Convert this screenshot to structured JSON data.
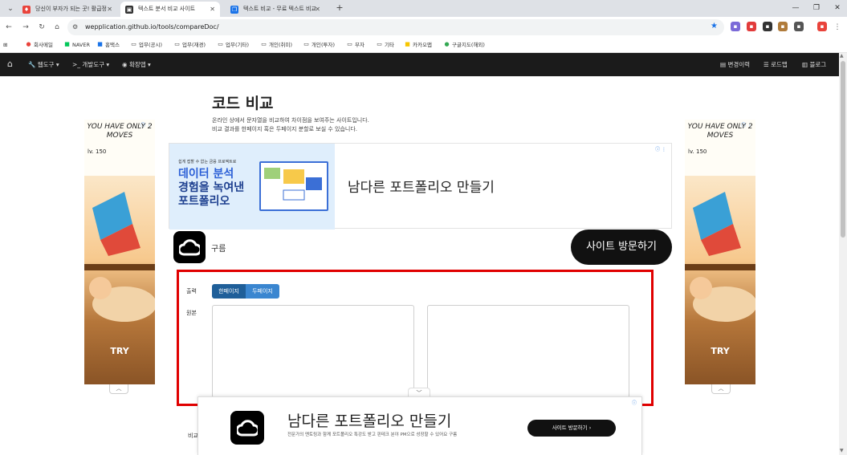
{
  "browser": {
    "tabs": [
      {
        "title": "당신이 부자가 되는 곳! 활급정",
        "active": false,
        "favicon_color": "#e9433b"
      },
      {
        "title": "텍스트 분서 비교 사이트",
        "active": true,
        "favicon_color": "#333333"
      },
      {
        "title": "텍스트 비교 - 무료 텍스트 비교",
        "active": false,
        "favicon_color": "#1a73e8"
      }
    ],
    "url": "wepplication.github.io/tools/compareDoc/",
    "bookmarks": [
      "회사메일",
      "NAVER",
      "홈택스",
      "업무(공시)",
      "업무(재경)",
      "업무(기타)",
      "개인(취미)",
      "개인(투자)",
      "부자",
      "기타",
      "카카오맵",
      "구글지도(해외)"
    ]
  },
  "navbar": {
    "left": [
      "웹도구 ▾",
      "개발도구 ▾",
      "확장앱 ▾"
    ],
    "right": [
      "변경이력",
      "로드맵",
      "블로그"
    ]
  },
  "page": {
    "title": "코드 비교",
    "desc1": "온라인 상에서 문자열을 비교하여 차이점을 보여주는 사이트입니다.",
    "desc2": "비교 결과를 한페이지 혹은 두페이지 분할로 보실 수 있습니다."
  },
  "side_ad": {
    "headline": "YOU HAVE ONLY 2 MOVES",
    "level": "lv. 150",
    "cta": "TRY"
  },
  "center_ad": {
    "small_text": "쉽게 접할 수 없는 금융 프로젝트로",
    "big1": "데이터 분석",
    "big2": "경험을 녹여낸",
    "big3": "포트폴리오",
    "heading": "남다른 포트폴리오 만들기",
    "brand": "구름",
    "visit": "사이트 방문하기"
  },
  "form": {
    "output_label": "출력",
    "one_page": "한페이지",
    "two_page": "두페이지",
    "source_label": "원본",
    "compare_label": "비교"
  },
  "anchor_ad": {
    "title": "남다른 포트폴리오 만들기",
    "sub": "전문가의 멘토링과 함께 포트폴리오 특강도 받고 핀테크 분야 PM으로 성장할 수 있어요 구름",
    "button": "사이트 방문하기  ›"
  },
  "colors": {
    "highlight": "#e00000",
    "navbar": "#1b1b1b",
    "segment_active": "#1f5f99"
  }
}
